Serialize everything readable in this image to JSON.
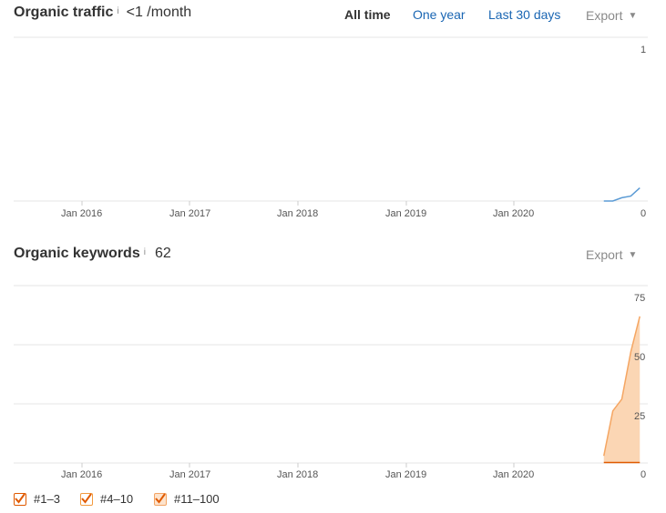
{
  "traffic": {
    "title": "Organic traffic",
    "info": "i",
    "value": "<1 /month",
    "ranges": [
      "All time",
      "One year",
      "Last 30 days"
    ],
    "export_label": "Export",
    "y_ticks": [
      "1",
      "0"
    ],
    "x_ticks": [
      "Jan 2016",
      "Jan 2017",
      "Jan 2018",
      "Jan 2019",
      "Jan 2020"
    ]
  },
  "keywords": {
    "title": "Organic keywords",
    "info": "i",
    "value": "62",
    "export_label": "Export",
    "y_ticks": [
      "75",
      "50",
      "25",
      "0"
    ],
    "x_ticks": [
      "Jan 2016",
      "Jan 2017",
      "Jan 2018",
      "Jan 2019",
      "Jan 2020"
    ]
  },
  "legend": [
    {
      "label": "#1–3",
      "checked": true,
      "color": "#e05a00"
    },
    {
      "label": "#4–10",
      "checked": true,
      "color": "#f39a3e"
    },
    {
      "label": "#11–100",
      "checked": true,
      "color": "#f8c9a0"
    }
  ],
  "chart_data": [
    {
      "type": "line",
      "ylabel": "",
      "ylim": [
        0,
        1
      ],
      "x_ticks": [
        "Jan 2016",
        "Jan 2017",
        "Jan 2018",
        "Jan 2019",
        "Jan 2020"
      ],
      "series": [
        {
          "x": [
            "2020-11",
            "2020-12",
            "2021-01",
            "2021-02",
            "2021-03"
          ],
          "values": [
            0,
            0,
            0.02,
            0.03,
            0.08
          ]
        }
      ]
    },
    {
      "type": "area",
      "ylim": [
        0,
        75
      ],
      "x_ticks": [
        "Jan 2016",
        "Jan 2017",
        "Jan 2018",
        "Jan 2019",
        "Jan 2020"
      ],
      "series": [
        {
          "name": "#1–3",
          "x": [
            "2020-11",
            "2021-03"
          ],
          "values": [
            0,
            0
          ]
        },
        {
          "name": "#4–10",
          "x": [
            "2020-11",
            "2021-03"
          ],
          "values": [
            0,
            0
          ]
        },
        {
          "name": "#11–100",
          "x": [
            "2020-11",
            "2020-12",
            "2021-01",
            "2021-02",
            "2021-03"
          ],
          "values": [
            3,
            22,
            27,
            47,
            62
          ]
        }
      ]
    }
  ],
  "colors": {
    "traffic_line": "#5b9bd5",
    "keywords_fill": "#fbd6b4",
    "keywords_line": "#f5a663",
    "top3_line": "#e05a00",
    "grid": "#e6e6e6",
    "link": "#1a66b3"
  }
}
